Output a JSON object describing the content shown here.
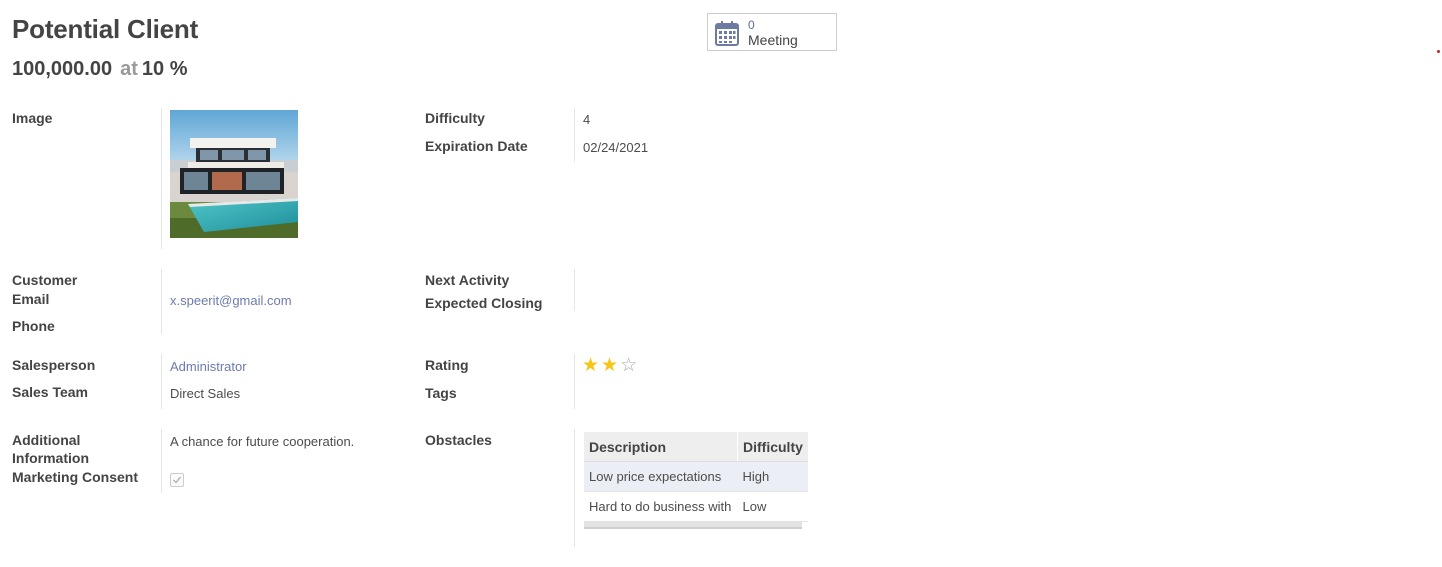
{
  "header": {
    "title": "Potential Client",
    "revenue": "100,000.00",
    "at": "at",
    "probability": "10 %"
  },
  "smart_button": {
    "count": "0",
    "label": "Meeting",
    "icon": "calendar-icon"
  },
  "fields": {
    "image_label": "Image",
    "difficulty_label": "Difficulty",
    "difficulty_value": "4",
    "expiration_label": "Expiration Date",
    "expiration_value": "02/24/2021",
    "customer_label": "Customer",
    "email_label": "Email",
    "email_value": "x.speerit@gmail.com",
    "phone_label": "Phone",
    "next_activity_label": "Next Activity",
    "expected_closing_label": "Expected Closing",
    "salesperson_label": "Salesperson",
    "salesperson_value": "Administrator",
    "sales_team_label": "Sales Team",
    "sales_team_value": "Direct Sales",
    "rating_label": "Rating",
    "rating_value": 2,
    "rating_max": 3,
    "tags_label": "Tags",
    "additional_info_label_line1": "Additional",
    "additional_info_label_line2": "Information",
    "additional_info_value": "A chance for future cooperation.",
    "marketing_consent_label": "Marketing Consent",
    "marketing_consent_checked": true,
    "obstacles_label": "Obstacles"
  },
  "obstacles": {
    "columns": [
      "Description",
      "Difficulty"
    ],
    "rows": [
      [
        "Low price expectations",
        "High"
      ],
      [
        "Hard to do business with",
        "Low"
      ]
    ]
  },
  "colors": {
    "link": "#6c7ab0",
    "star": "#f5c518",
    "accent_dot": "#cc2222"
  }
}
